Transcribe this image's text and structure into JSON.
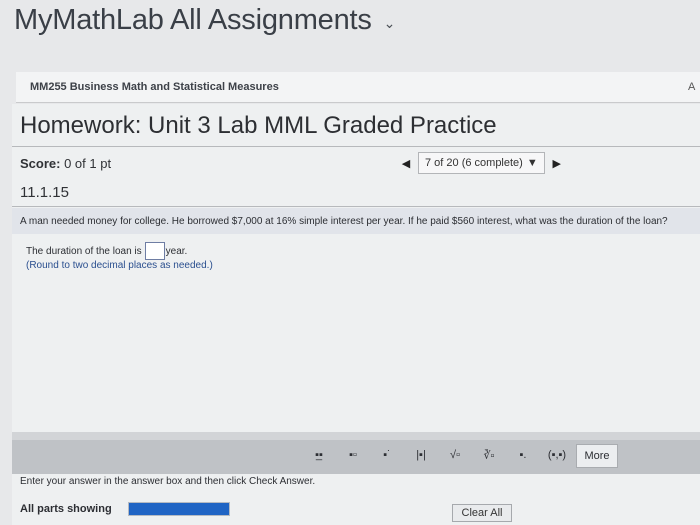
{
  "app": {
    "title": "MyMathLab All Assignments",
    "chevron_icon": "chevron-down-icon"
  },
  "course_bar": {
    "name": "MM255 Business Math and Statistical Measures",
    "right_text": "A"
  },
  "homework": {
    "title": "Homework: Unit 3 Lab MML Graded Practice",
    "score_label": "Score:",
    "score_value": "0 of 1 pt",
    "question_number": "11.1.15"
  },
  "nav": {
    "prev_icon": "triangle-left-icon",
    "next_icon": "triangle-right-icon",
    "progress_text": "7 of 20 (6 complete)",
    "dropdown_icon": "triangle-down-icon"
  },
  "question": {
    "text": "A man needed money for college. He borrowed $7,000 at 16% simple interest per year. If he paid $560 interest, what was the duration of the loan?",
    "answer_prefix": "The duration of the loan is",
    "answer_value": "",
    "answer_suffix": "year.",
    "hint": "(Round to two decimal places as needed.)"
  },
  "toolbar": {
    "tools": [
      {
        "name": "fraction-tool",
        "glyph": "▪̲▪"
      },
      {
        "name": "mixed-number-tool",
        "glyph": "▪▫"
      },
      {
        "name": "exponent-tool",
        "glyph": "▪˙"
      },
      {
        "name": "absolute-value-tool",
        "glyph": "|▪|"
      },
      {
        "name": "square-root-tool",
        "glyph": "√▫"
      },
      {
        "name": "nth-root-tool",
        "glyph": "∛▫"
      },
      {
        "name": "decimal-tool",
        "glyph": "▪."
      },
      {
        "name": "ordered-pair-tool",
        "glyph": "(▪,▪)"
      }
    ],
    "more_label": "More"
  },
  "footer": {
    "instruction": "Enter your answer in the answer box and then click Check Answer.",
    "parts_label": "All parts showing",
    "progress": 1.0,
    "clear_label": "Clear All"
  },
  "colors": {
    "accent": "#1f64c4",
    "hint": "#2a4f8f"
  }
}
